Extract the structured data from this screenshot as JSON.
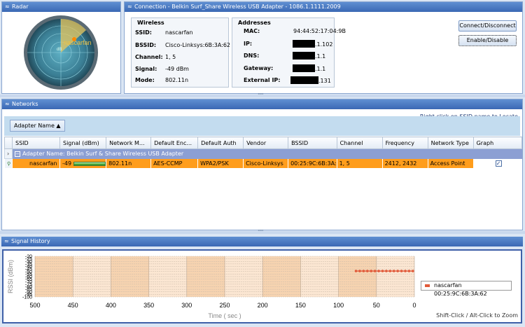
{
  "radar": {
    "title": "Radar",
    "blip_label": "nascarfan",
    "center_label": "dB"
  },
  "connection": {
    "title": "Connection - Belkin Surf_Share Wireless USB Adapter - 1086.1.1111.2009",
    "wireless": {
      "heading": "Wireless",
      "ssid_label": "SSID:",
      "ssid": "nascarfan",
      "bssid_label": "BSSID:",
      "bssid": "Cisco-Linksys:6B:3A:62",
      "channel_label": "Channel:",
      "channel": "1, 5",
      "signal_label": "Signal:",
      "signal": "-49 dBm",
      "mode_label": "Mode:",
      "mode": "802.11n"
    },
    "addresses": {
      "heading": "Addresses",
      "mac_label": "MAC:",
      "mac": "94:44:52:17:04:9B",
      "ip_label": "IP:",
      "ip_tail": ".1.102",
      "dns_label": "DNS:",
      "dns_tail": ".1.1",
      "gateway_label": "Gateway:",
      "gateway_tail": ".1.1",
      "external_label": "External IP:",
      "external_tail": ".131"
    },
    "buttons": {
      "connect": "Connect/Disconnect",
      "enable": "Enable/Disable"
    }
  },
  "networks": {
    "title": "Networks",
    "hint": "Right click on SSID name to Locate",
    "group_button": "Adapter Name ▲",
    "columns": [
      "SSID",
      "Signal (dBm)",
      "Network M...",
      "Default Enc...",
      "Default Auth",
      "Vendor",
      "BSSID",
      "Channel",
      "Frequency",
      "Network Type",
      "Graph"
    ],
    "group_row": "Adapter Name: Belkin Surf & Share Wireless USB Adapter",
    "rows": [
      {
        "ssid": "nascarfan",
        "signal": "-49",
        "mode": "802.11n",
        "enc": "AES-CCMP",
        "auth": "WPA2/PSK",
        "vendor": "Cisco-Linksys",
        "bssid": "00:25:9C:6B:3A:",
        "channel": "1, 5",
        "frequency": "2412, 2432",
        "type": "Access Point",
        "graph": "✓"
      }
    ]
  },
  "signal_history": {
    "title": "Signal History",
    "legend": "nascarfan 00:25:9C:6B:3A:62",
    "zoom_hint": "Shift-Click / Alt-Click to Zoom"
  },
  "colors": {
    "titlebar": "#3a68b4",
    "row_highlight": "#ff9d1c",
    "series": "#e15a3a",
    "grid_band": "#f6d3b0"
  },
  "chart_data": {
    "type": "line",
    "xlabel": "Time ( sec )",
    "ylabel": "RSSI (dBm)",
    "x_ticks": [
      500,
      450,
      400,
      350,
      300,
      250,
      200,
      150,
      100,
      50,
      0
    ],
    "y_ticks": [
      -20,
      -25,
      -30,
      -35,
      -40,
      -45,
      -50,
      -55,
      -60,
      -65,
      -70,
      -75,
      -80,
      -85,
      -90,
      -95,
      -100
    ],
    "xlim": [
      500,
      0
    ],
    "ylim": [
      -100,
      -20
    ],
    "x_reversed": true,
    "grid": true,
    "series": [
      {
        "name": "nascarfan 00:25:9C:6B:3A:62",
        "x": [
          77,
          72,
          67,
          62,
          57,
          52,
          47,
          42,
          37,
          32,
          27,
          22,
          17,
          12,
          7,
          2
        ],
        "values": [
          -49,
          -49,
          -49,
          -49,
          -49,
          -49,
          -49,
          -49,
          -49,
          -49,
          -49,
          -49,
          -49,
          -49,
          -49,
          -49
        ]
      }
    ]
  }
}
